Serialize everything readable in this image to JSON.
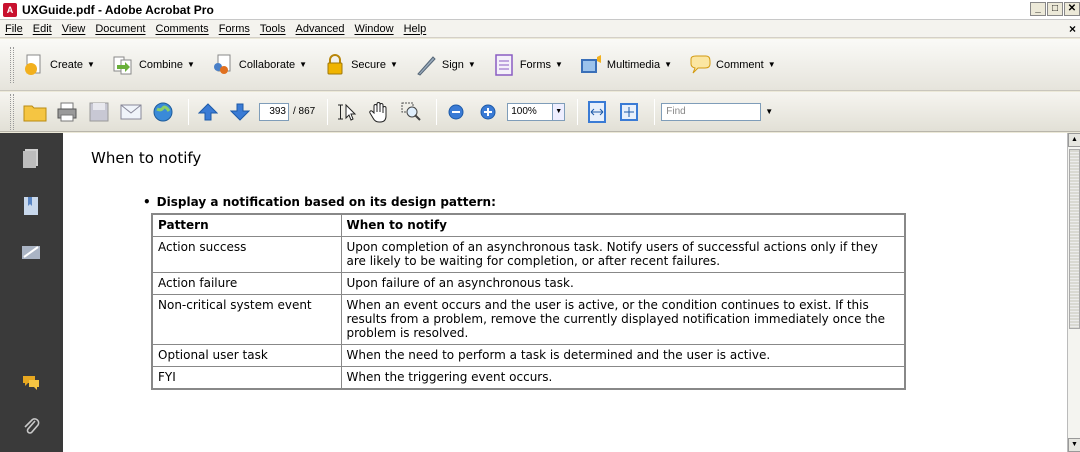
{
  "window": {
    "title": "UXGuide.pdf - Adobe Acrobat Pro",
    "min": "_",
    "max": "□",
    "close": "✕"
  },
  "menu": [
    "File",
    "Edit",
    "View",
    "Document",
    "Comments",
    "Forms",
    "Tools",
    "Advanced",
    "Window",
    "Help"
  ],
  "menu_close": "×",
  "tasks": [
    {
      "label": "Create",
      "icon": "create-icon"
    },
    {
      "label": "Combine",
      "icon": "combine-icon"
    },
    {
      "label": "Collaborate",
      "icon": "collaborate-icon"
    },
    {
      "label": "Secure",
      "icon": "lock-icon"
    },
    {
      "label": "Sign",
      "icon": "pen-icon"
    },
    {
      "label": "Forms",
      "icon": "forms-icon"
    },
    {
      "label": "Multimedia",
      "icon": "multimedia-icon"
    },
    {
      "label": "Comment",
      "icon": "comment-icon"
    }
  ],
  "nav": {
    "page_current": "393",
    "page_total": "/ 867",
    "zoom": "100%",
    "find_placeholder": "Find"
  },
  "doc": {
    "heading": "When to notify",
    "bullet": "Display a notification based on its design pattern:",
    "table": {
      "headers": [
        "Pattern",
        "When to notify"
      ],
      "rows": [
        [
          "Action success",
          "Upon completion of an asynchronous task. Notify users of successful actions only if they are likely to be waiting for completion, or after recent failures."
        ],
        [
          "Action failure",
          "Upon failure of an asynchronous task."
        ],
        [
          "Non-critical system event",
          "When an event occurs and the user is active, or the condition continues to exist. If this results from a problem, remove the currently displayed notification immediately once the problem is resolved."
        ],
        [
          "Optional user task",
          "When the need to perform a task is determined and the user is active."
        ],
        [
          "FYI",
          "When the triggering event occurs."
        ]
      ]
    }
  },
  "colors": {
    "left_panel": "#3a3a3a",
    "acrobat_red": "#c8102e",
    "nav_blue": "#3a7bd5"
  }
}
